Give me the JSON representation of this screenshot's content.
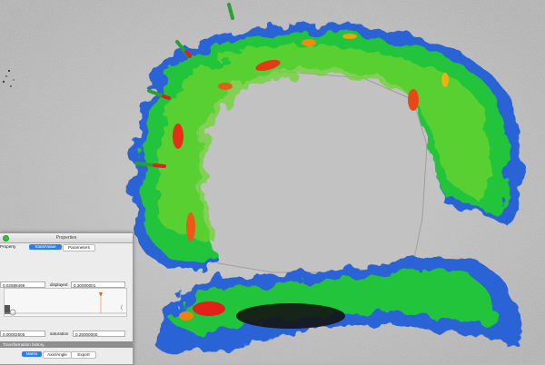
{
  "panel": {
    "title": "Properties",
    "tabs": [
      "Property",
      "Stats/Value",
      "Parameters"
    ],
    "min_value": "0.02588496",
    "displayed_label": "displayed",
    "displayed_value": "0.30000001",
    "saturation_min_value": "0.00002505",
    "saturation_label": "saturation",
    "saturation_value": "0.25000000",
    "section_label": "Transformation history",
    "bottom_tabs": [
      "Matrix",
      "Axis/Angle",
      "Export"
    ],
    "icons": [
      "close-dot-icon",
      "slider-handle-icon",
      "orange-triangle-marker-icon",
      "c-icon"
    ]
  },
  "colors": {
    "selection_blue": "#2a7ff2",
    "close_green": "#2fc145",
    "deviation_low": "#1f4fd1",
    "deviation_mid": "#18c83a",
    "deviation_high": "#e82020"
  }
}
